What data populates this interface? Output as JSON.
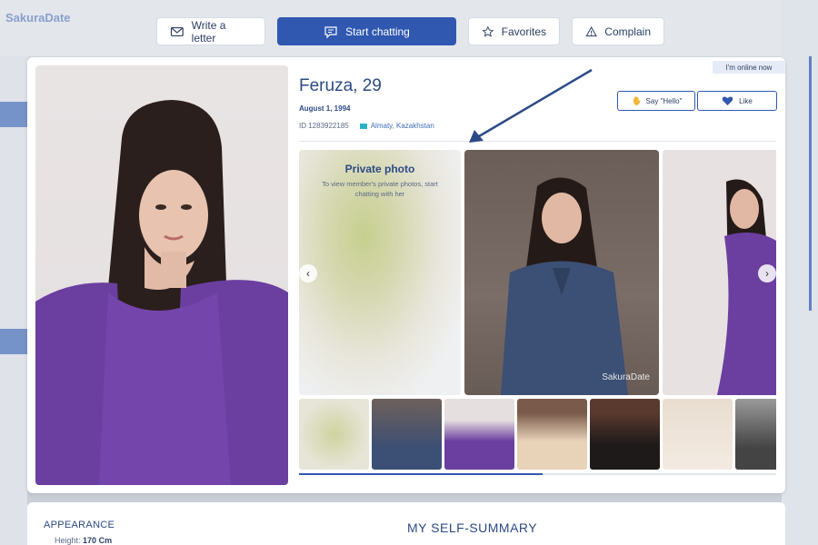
{
  "background": {
    "logo": "SakuraDate"
  },
  "actions": [
    {
      "label": "Write a letter",
      "icon": "envelope-icon"
    },
    {
      "label": "Start chatting",
      "icon": "chat-icon"
    },
    {
      "label": "Favorites",
      "icon": "star-icon"
    },
    {
      "label": "Complain",
      "icon": "warning-icon"
    }
  ],
  "profile": {
    "online_badge": "I'm online now",
    "name": "Feruza, 29",
    "birthday": "August 1, 1994",
    "id": "ID 1283922185",
    "location": "Almaty, Kazakhstan",
    "say_hello": "Say \"Hello\"",
    "like": "Like"
  },
  "gallery": {
    "private_title": "Private photo",
    "private_text": "To view member's private photos, start chatting with her",
    "watermark": "SakuraDate",
    "progress": 0.51
  },
  "thumbnails": [
    "private-blur",
    "blue-suit",
    "purple-dress",
    "beige-top",
    "black-dress",
    "lace-gown",
    "bw-portrait"
  ],
  "bottom": {
    "appearance_label": "APPEARANCE",
    "height_label": "Height:",
    "height_value": "170 Cm",
    "summary_title": "MY SELF-SUMMARY"
  },
  "colors": {
    "accent": "#3058b0",
    "text": "#2c4a86",
    "dress": "#6b3fa0",
    "suit": "#3c4f74"
  }
}
